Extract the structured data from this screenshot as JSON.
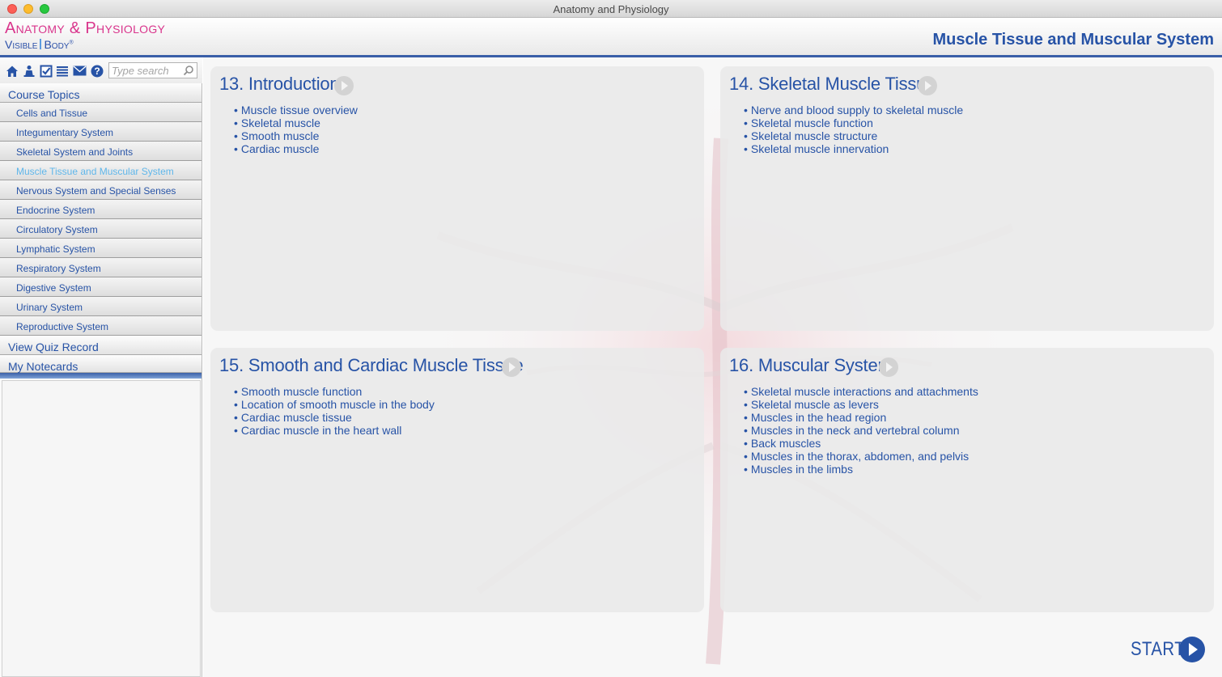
{
  "window": {
    "title": "Anatomy and Physiology"
  },
  "logo": {
    "line1": "Anatomy & Physiology",
    "brand_a": "Visible",
    "brand_b": "Body",
    "brand_mark": "®"
  },
  "page_title": "Muscle Tissue and Muscular System",
  "toolbar": {
    "icons": [
      "home-icon",
      "person-icon",
      "checkmark-icon",
      "list-icon",
      "mail-icon",
      "help-icon"
    ],
    "search_placeholder": "Type search"
  },
  "sidebar": {
    "course_topics_label": "Course Topics",
    "topics": [
      {
        "label": "Cells and Tissue"
      },
      {
        "label": "Integumentary System"
      },
      {
        "label": "Skeletal System and Joints"
      },
      {
        "label": "Muscle Tissue and Muscular System",
        "active": true
      },
      {
        "label": "Nervous System and Special Senses"
      },
      {
        "label": "Endocrine System"
      },
      {
        "label": "Circulatory System"
      },
      {
        "label": "Lymphatic System"
      },
      {
        "label": "Respiratory System"
      },
      {
        "label": "Digestive System"
      },
      {
        "label": "Urinary System"
      },
      {
        "label": "Reproductive System"
      }
    ],
    "quiz_label": "View Quiz Record",
    "notecards_label": "My Notecards"
  },
  "panels": [
    {
      "title": "13. Introduction",
      "items": [
        "Muscle tissue overview",
        "Skeletal muscle",
        "Smooth muscle",
        "Cardiac muscle"
      ]
    },
    {
      "title": "14. Skeletal Muscle Tissue",
      "items": [
        "Nerve and blood supply to skeletal muscle",
        "Skeletal muscle function",
        "Skeletal muscle structure",
        "Skeletal muscle innervation"
      ]
    },
    {
      "title": "15. Smooth and Cardiac Muscle Tissue",
      "items": [
        "Smooth muscle function",
        "Location of smooth muscle in the body",
        "Cardiac muscle tissue",
        "Cardiac muscle in the heart wall"
      ]
    },
    {
      "title": "16. Muscular System",
      "items": [
        "Skeletal muscle interactions and attachments",
        "Skeletal muscle as levers",
        "Muscles in the head region",
        "Muscles in the neck and vertebral column",
        "Back muscles",
        "Muscles in the thorax, abdomen, and pelvis",
        "Muscles in the limbs"
      ]
    }
  ],
  "start_label": "START",
  "colors": {
    "accent": "#2753a6",
    "active_topic": "#5fb6ea",
    "logo_pink": "#d9358c"
  }
}
